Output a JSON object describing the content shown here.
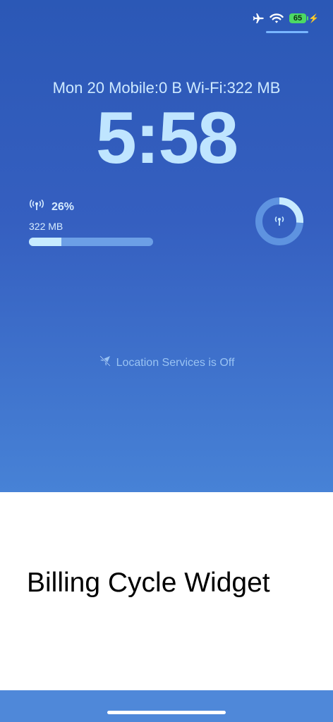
{
  "status_bar": {
    "battery_level": "65",
    "icons": [
      "airplane-icon",
      "wifi-icon",
      "battery-icon",
      "bolt-icon"
    ]
  },
  "lock_screen": {
    "date_line": "Mon 20  Mobile:0 B  Wi-Fi:322 MB",
    "time": "5:58",
    "widget": {
      "percent": "26%",
      "usage": "322 MB",
      "progress": 0.26
    },
    "location_notice": "Location Services is Off"
  },
  "promo": {
    "title": "Billing Cycle Widget"
  },
  "colors": {
    "lock_top": "#2b58b6",
    "lock_bottom": "#4782d6",
    "clock_text": "#bfe5ff",
    "bar_fill": "#c7ebff",
    "bar_track": "#6c9fe6",
    "battery": "#4cd964",
    "bottom_strip": "#4f88d9"
  }
}
